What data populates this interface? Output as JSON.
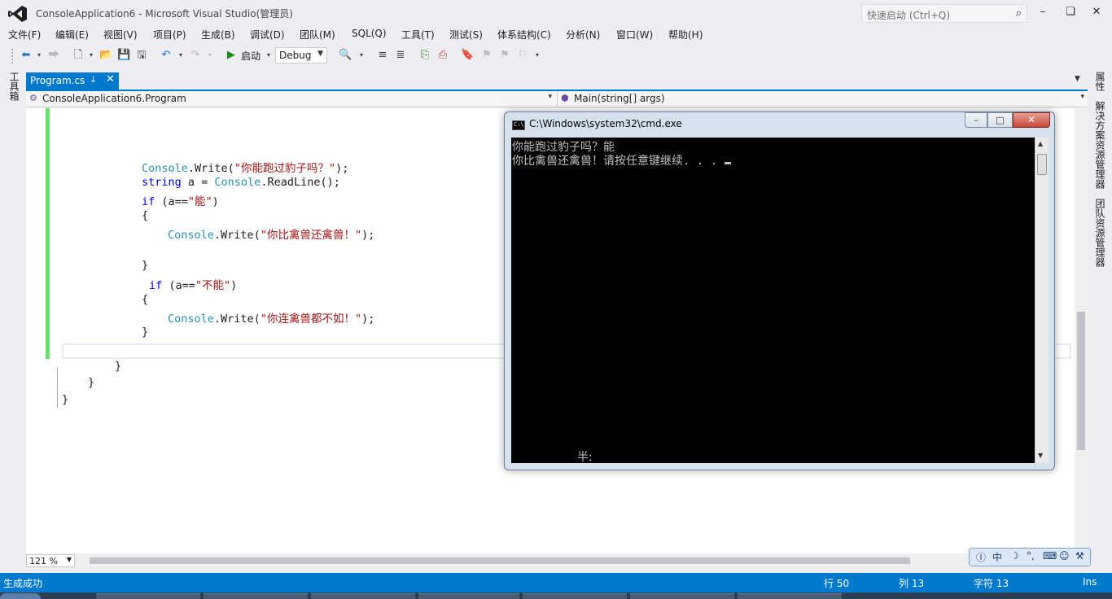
{
  "window": {
    "title": "ConsoleApplication6 - Microsoft Visual Studio(管理员)",
    "quick_launch_placeholder": "快速启动 (Ctrl+Q)"
  },
  "menu": [
    "文件(F)",
    "编辑(E)",
    "视图(V)",
    "项目(P)",
    "生成(B)",
    "调试(D)",
    "团队(M)",
    "SQL(Q)",
    "工具(T)",
    "测试(S)",
    "体系结构(C)",
    "分析(N)",
    "窗口(W)",
    "帮助(H)"
  ],
  "toolbar": {
    "start_label": "启动",
    "config": "Debug"
  },
  "left_strip": {
    "toolbox_label": "工具箱"
  },
  "right_strip": {
    "properties": "属性",
    "solution_explorer": "解决方案资源管理器",
    "team_explorer": "团队资源管理器"
  },
  "document_tab": {
    "label": "Program.cs"
  },
  "navbar": {
    "type": "ConsoleApplication6.Program",
    "member": "Main(string[] args)"
  },
  "code": {
    "l1_a": "Console",
    "l1_b": ".Write(",
    "l1_c": "\"你能跑过豹子吗？\"",
    "l1_d": ");",
    "l2_a": "string",
    "l2_b": " a = ",
    "l2_c": "Console",
    "l2_d": ".ReadLine();",
    "l3_a": "if",
    "l3_b": " (a==",
    "l3_c": "\"能\"",
    "l3_d": ")",
    "l4": "{",
    "l5_a": "Console",
    "l5_b": ".Write(",
    "l5_c": "\"你比禽兽还禽兽！\"",
    "l5_d": ");",
    "l6": "}",
    "l7_a": "if",
    "l7_b": " (a==",
    "l7_c": "\"不能\"",
    "l7_d": ")",
    "l8": "{",
    "l9_a": "Console",
    "l9_b": ".Write(",
    "l9_c": "\"你连禽兽都不如！\"",
    "l9_d": ");",
    "l10": "}",
    "l11": "}",
    "l12": "}",
    "l13": "}"
  },
  "zoom": "121 %",
  "status": {
    "message": "生成成功",
    "line": "行 50",
    "col": "列 13",
    "char": "字符 13",
    "mode": "Ins"
  },
  "cmd": {
    "title": "C:\\Windows\\system32\\cmd.exe",
    "line1": "你能跑过豹子吗？能",
    "line2": "你比禽兽还禽兽！请按任意键继续. . . ",
    "ime_text": "半:"
  },
  "ime": {
    "mode": "中"
  },
  "colors": {
    "accent": "#007acc",
    "keyword": "#0000ff",
    "type": "#2b91af",
    "string": "#a31515"
  }
}
